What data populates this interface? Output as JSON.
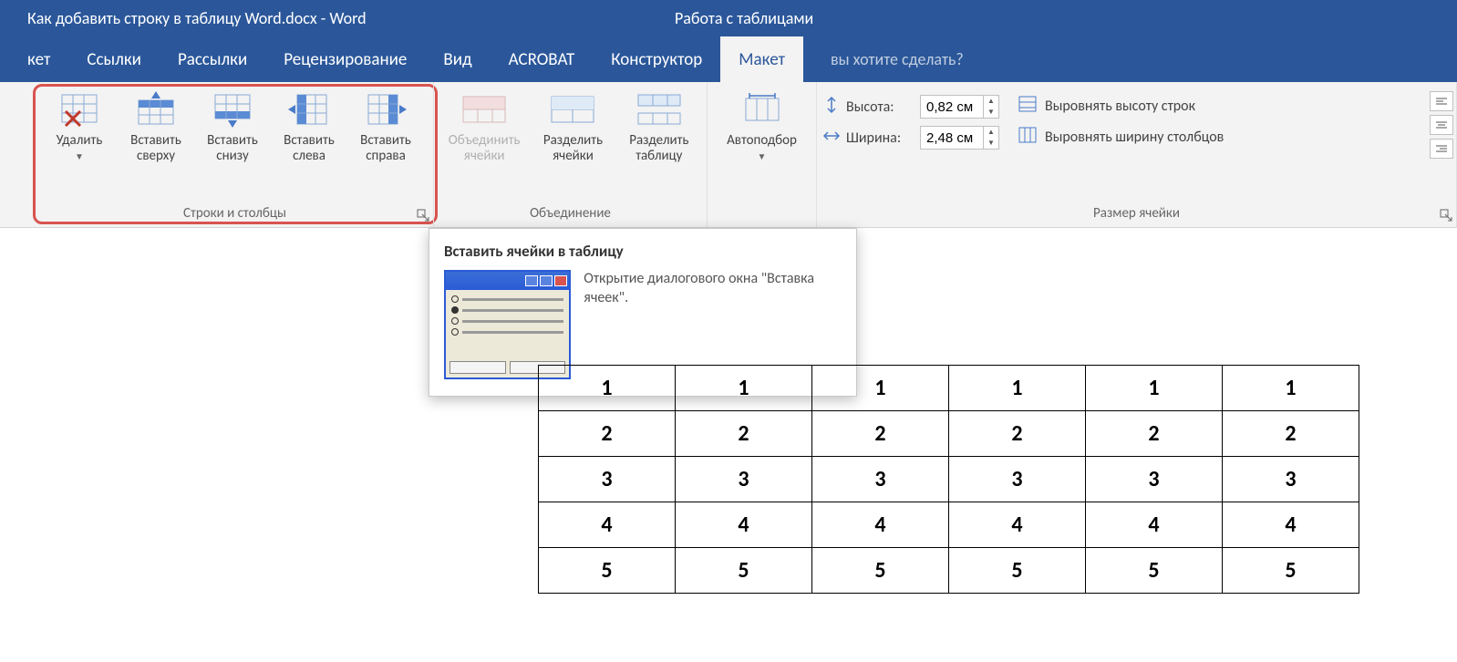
{
  "title": "Как добавить строку в таблицу Word.docx - Word",
  "table_tools_label": "Работа с таблицами",
  "tabs": {
    "ket": "кет",
    "links": "Ссылки",
    "mailings": "Рассылки",
    "review": "Рецензирование",
    "view": "Вид",
    "acrobat": "ACROBAT",
    "design": "Конструктор",
    "layout": "Макет"
  },
  "tell_me": "вы хотите сделать?",
  "groups": {
    "rows_cols": {
      "delete": "Удалить",
      "insert_above": "Вставить сверху",
      "insert_below": "Вставить снизу",
      "insert_left": "Вставить слева",
      "insert_right": "Вставить справа",
      "label": "Строки и столбцы"
    },
    "merge": {
      "merge_cells": "Объединить ячейки",
      "split_cells": "Разделить ячейки",
      "split_table": "Разделить таблицу",
      "label": "Объединение"
    },
    "autofit": "Автоподбор",
    "cell_size": {
      "height_label": "Высота:",
      "height_value": "0,82 см",
      "width_label": "Ширина:",
      "width_value": "2,48 см",
      "dist_rows": "Выровнять высоту строк",
      "dist_cols": "Выровнять ширину столбцов",
      "label": "Размер ячейки"
    }
  },
  "tooltip": {
    "title": "Вставить ячейки в таблицу",
    "desc": "Открытие диалогового окна \"Вставка ячеек\"."
  },
  "table_data": [
    [
      "1",
      "1",
      "1",
      "1",
      "1",
      "1"
    ],
    [
      "2",
      "2",
      "2",
      "2",
      "2",
      "2"
    ],
    [
      "3",
      "3",
      "3",
      "3",
      "3",
      "3"
    ],
    [
      "4",
      "4",
      "4",
      "4",
      "4",
      "4"
    ],
    [
      "5",
      "5",
      "5",
      "5",
      "5",
      "5"
    ]
  ]
}
